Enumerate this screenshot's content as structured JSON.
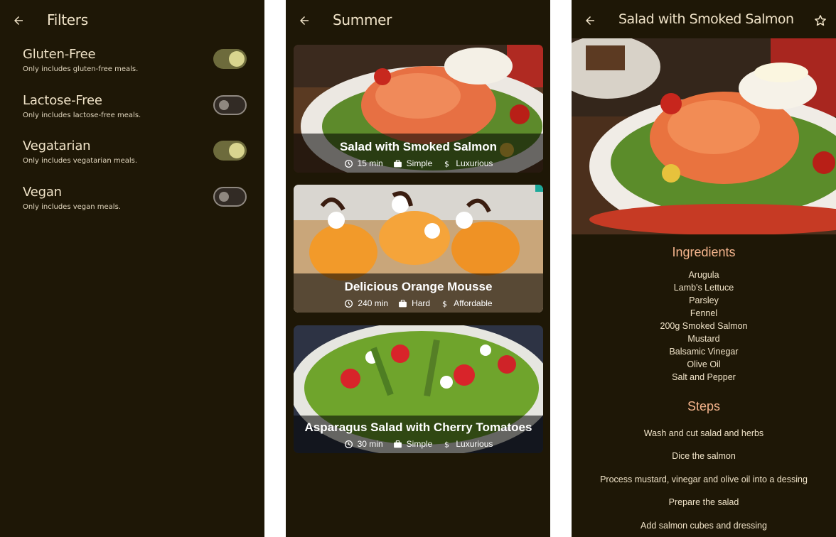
{
  "colors": {
    "background": "#1e1706",
    "text": "#f0e3c8",
    "accent": "#f4b48c",
    "switch_on_track": "#6d6b3c",
    "switch_on_knob": "#d9d58f"
  },
  "filters_screen": {
    "title": "Filters",
    "back_icon": "arrow-left-icon",
    "items": [
      {
        "title": "Gluten-Free",
        "subtitle": "Only includes gluten-free meals.",
        "enabled": true
      },
      {
        "title": "Lactose-Free",
        "subtitle": "Only includes lactose-free meals.",
        "enabled": false
      },
      {
        "title": "Vegatarian",
        "subtitle": "Only includes vegatarian meals.",
        "enabled": true
      },
      {
        "title": "Vegan",
        "subtitle": "Only includes vegan meals.",
        "enabled": false
      }
    ]
  },
  "meals_screen": {
    "title": "Summer",
    "back_icon": "arrow-left-icon",
    "meals": [
      {
        "title": "Salad with Smoked Salmon",
        "duration": "15 min",
        "complexity": "Simple",
        "affordability": "Luxurious"
      },
      {
        "title": "Delicious Orange Mousse",
        "duration": "240 min",
        "complexity": "Hard",
        "affordability": "Affordable"
      },
      {
        "title": "Asparagus Salad with Cherry Tomatoes",
        "duration": "30 min",
        "complexity": "Simple",
        "affordability": "Luxurious"
      }
    ]
  },
  "detail_screen": {
    "title": "Salad with Smoked Salmon",
    "back_icon": "arrow-left-icon",
    "favorite_icon": "star-outline-icon",
    "ingredients_heading": "Ingredients",
    "ingredients": [
      "Arugula",
      "Lamb's Lettuce",
      "Parsley",
      "Fennel",
      "200g Smoked Salmon",
      "Mustard",
      "Balsamic Vinegar",
      "Olive Oil",
      "Salt and Pepper"
    ],
    "steps_heading": "Steps",
    "steps": [
      "Wash and cut salad and herbs",
      "Dice the salmon",
      "Process mustard, vinegar and olive oil into a dessing",
      "Prepare the salad",
      "Add salmon cubes and dressing"
    ]
  }
}
